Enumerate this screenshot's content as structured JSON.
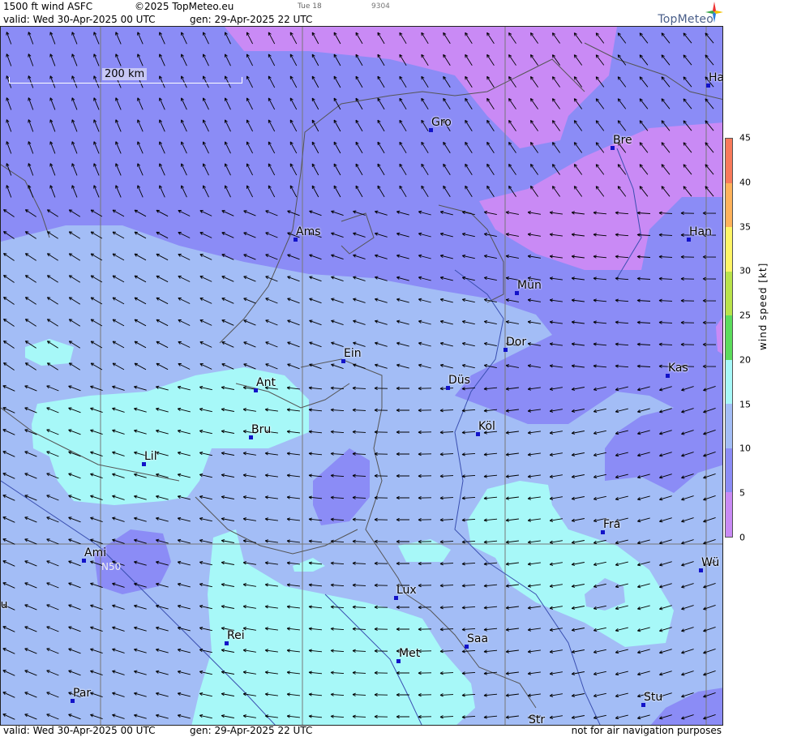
{
  "header": {
    "product": "1500 ft wind ASFC",
    "copyright": "©2025 TopMeteo.eu",
    "day_code": "Tue 18",
    "code": "9304",
    "valid": "valid:  Wed  30-Apr-2025  00 UTC",
    "generated": "gen:  29-Apr-2025 22 UTC"
  },
  "logo": {
    "text": "TopMeteo"
  },
  "footer": {
    "valid": "valid:  Wed  30-Apr-2025  00 UTC",
    "generated": "gen:  29-Apr-2025 22 UTC",
    "disclaimer": "not for air navigation purposes"
  },
  "scale": {
    "label": "200 km"
  },
  "latitude_label": "N50",
  "legend": {
    "title": "wind  speed  [kt]",
    "ticks": [
      "45",
      "40",
      "35",
      "30",
      "25",
      "20",
      "15",
      "10",
      "5",
      "0"
    ],
    "colors": {
      "0-5": "#c98af5",
      "5-10": "#8b8cf6",
      "10-15": "#a3bdf6",
      "15-20": "#a7f8f8",
      "20-25": "#5cdc5c",
      "25-30": "#b9e34a",
      "30-35": "#fff566",
      "35-40": "#ffb25a",
      "40-45": "#f87a5a"
    }
  },
  "cities": [
    {
      "name": "Gro"
    },
    {
      "name": "Bre"
    },
    {
      "name": "Ha"
    },
    {
      "name": "Ams"
    },
    {
      "name": "Han"
    },
    {
      "name": "Mün"
    },
    {
      "name": "Dor"
    },
    {
      "name": "Ein"
    },
    {
      "name": "Ant"
    },
    {
      "name": "Düs"
    },
    {
      "name": "Kas"
    },
    {
      "name": "Bru"
    },
    {
      "name": "Köl"
    },
    {
      "name": "Lil"
    },
    {
      "name": "Fra"
    },
    {
      "name": "Ami"
    },
    {
      "name": "Wü"
    },
    {
      "name": "Lux"
    },
    {
      "name": "Rei"
    },
    {
      "name": "Saa"
    },
    {
      "name": "Met"
    },
    {
      "name": "Par"
    },
    {
      "name": "Stu"
    },
    {
      "name": "Str"
    },
    {
      "name": "ou"
    }
  ]
}
